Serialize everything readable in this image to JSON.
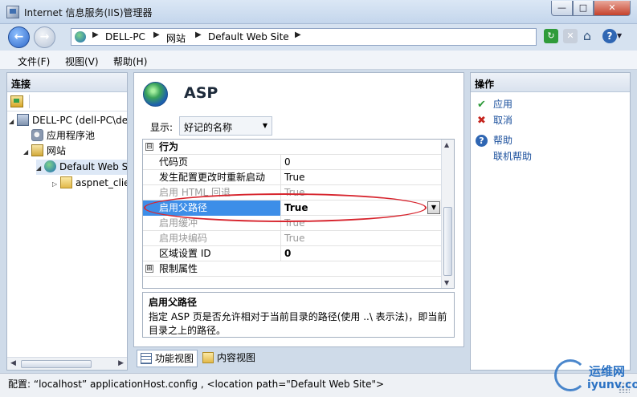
{
  "window": {
    "title": "Internet 信息服务(IIS)管理器",
    "controls": {
      "minimize": "—",
      "maximize": "□",
      "close": "✕"
    }
  },
  "address": {
    "breadcrumbs": [
      "DELL-PC",
      "网站",
      "Default Web Site"
    ],
    "separator": "▶"
  },
  "nav": {
    "back": "←",
    "forward": "→"
  },
  "toolbar": {
    "refresh": "↻",
    "stop": "✕",
    "home": "⌂",
    "help": "?",
    "help_dropdown": "▼"
  },
  "menu": [
    "文件(F)",
    "视图(V)",
    "帮助(H)"
  ],
  "connections": {
    "title": "连接",
    "tree": [
      {
        "label": "DELL-PC (dell-PC\\del",
        "icon": "server-icon",
        "expander": "◢"
      },
      {
        "label": "应用程序池",
        "icon": "app-pool-icon",
        "expander": ""
      },
      {
        "label": "网站",
        "icon": "sites-folder-icon",
        "expander": "◢"
      },
      {
        "label": "Default Web S",
        "icon": "globe-icon",
        "expander": "◢"
      },
      {
        "label": "aspnet_clie",
        "icon": "folder-icon",
        "expander": "▷"
      }
    ]
  },
  "feature": {
    "title": "ASP",
    "display_label": "显示:",
    "display_value": "好记的名称",
    "dropdown_caret": "▼"
  },
  "properties": [
    {
      "type": "category",
      "name": "行为",
      "box": "⊟"
    },
    {
      "type": "prop",
      "name": "代码页",
      "value": "0"
    },
    {
      "type": "prop",
      "name": "发生配置更改时重新启动",
      "value": "True"
    },
    {
      "type": "prop",
      "name": "启用 HTML 回退",
      "value": "True",
      "dim": true
    },
    {
      "type": "prop",
      "name": "启用父路径",
      "value": "True",
      "selected": true
    },
    {
      "type": "prop",
      "name": "启用缓冲",
      "value": "True",
      "dim": true
    },
    {
      "type": "prop",
      "name": "启用块编码",
      "value": "True",
      "dim": true
    },
    {
      "type": "prop",
      "name": "区域设置 ID",
      "value": "0",
      "bold_value": true
    },
    {
      "type": "category",
      "name": "限制属性",
      "box": "⊞"
    }
  ],
  "description": {
    "title": "启用父路径",
    "text": "指定 ASP 页是否允许相对于当前目录的路径(使用 ..\\ 表示法)，即当前目录之上的路径。"
  },
  "view_tabs": {
    "features": "功能视图",
    "content": "内容视图"
  },
  "actions": {
    "title": "操作",
    "apply": "应用",
    "cancel": "取消",
    "help": "帮助",
    "online_help": "联机帮助",
    "icons": {
      "apply": "✔",
      "cancel": "✖",
      "help": "?"
    }
  },
  "status": {
    "text": "配置: “localhost”  applicationHost.config , <location path=\"Default Web Site\">"
  },
  "watermark": {
    "top": "运维网",
    "bottom": "iyunv.com"
  },
  "colors": {
    "selection": "#3d8ee8",
    "highlight_ring": "#d7252e",
    "link": "#1a4f9c"
  }
}
